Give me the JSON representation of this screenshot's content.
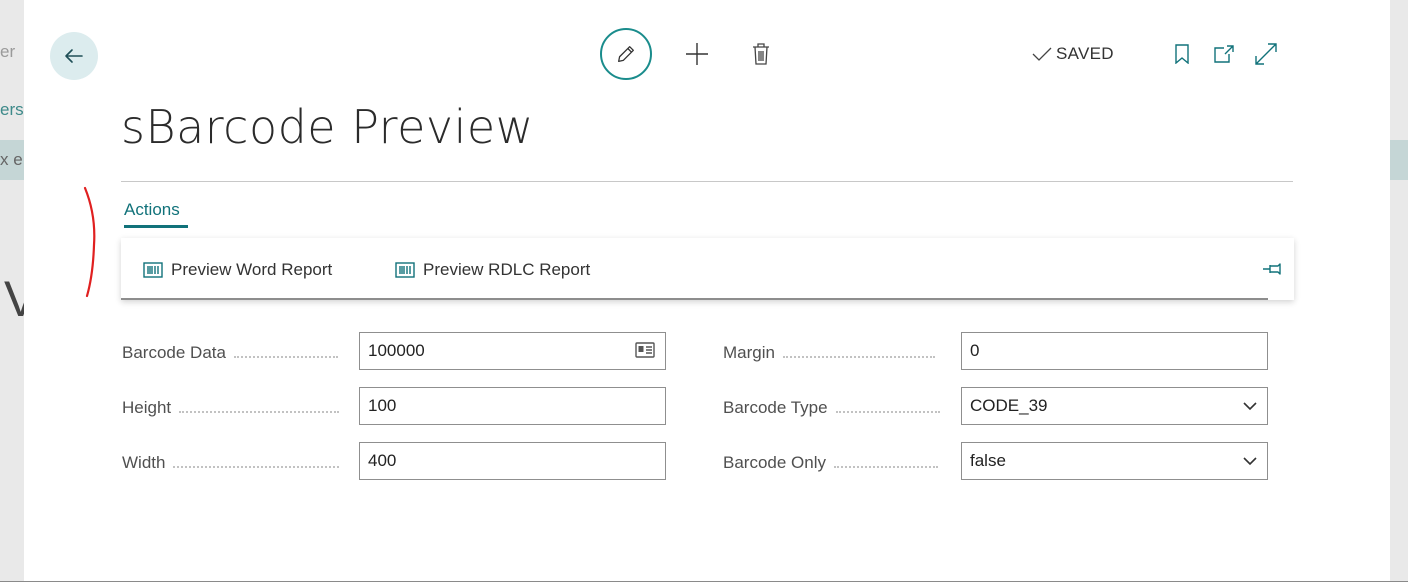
{
  "background": {
    "left_fragments": [
      "er",
      "ers",
      "x e",
      "V"
    ]
  },
  "header": {
    "back_icon": "arrow-left-icon",
    "status": "SAVED"
  },
  "page": {
    "title": "sBarcode Preview"
  },
  "actions": {
    "tab_label": "Actions",
    "items": [
      {
        "label": "Preview Word Report",
        "icon": "barcode-icon"
      },
      {
        "label": "Preview RDLC Report",
        "icon": "barcode-icon"
      }
    ],
    "pin_icon": "pin-icon"
  },
  "fields": {
    "barcode_data": {
      "label": "Barcode Data",
      "value": "100000"
    },
    "height": {
      "label": "Height",
      "value": "100"
    },
    "width": {
      "label": "Width",
      "value": "400"
    },
    "margin": {
      "label": "Margin",
      "value": "0"
    },
    "barcode_type": {
      "label": "Barcode Type",
      "value": "CODE_39"
    },
    "barcode_only": {
      "label": "Barcode Only",
      "value": "false"
    }
  },
  "colors": {
    "accent": "#11727a",
    "annotation": "#e02020"
  }
}
